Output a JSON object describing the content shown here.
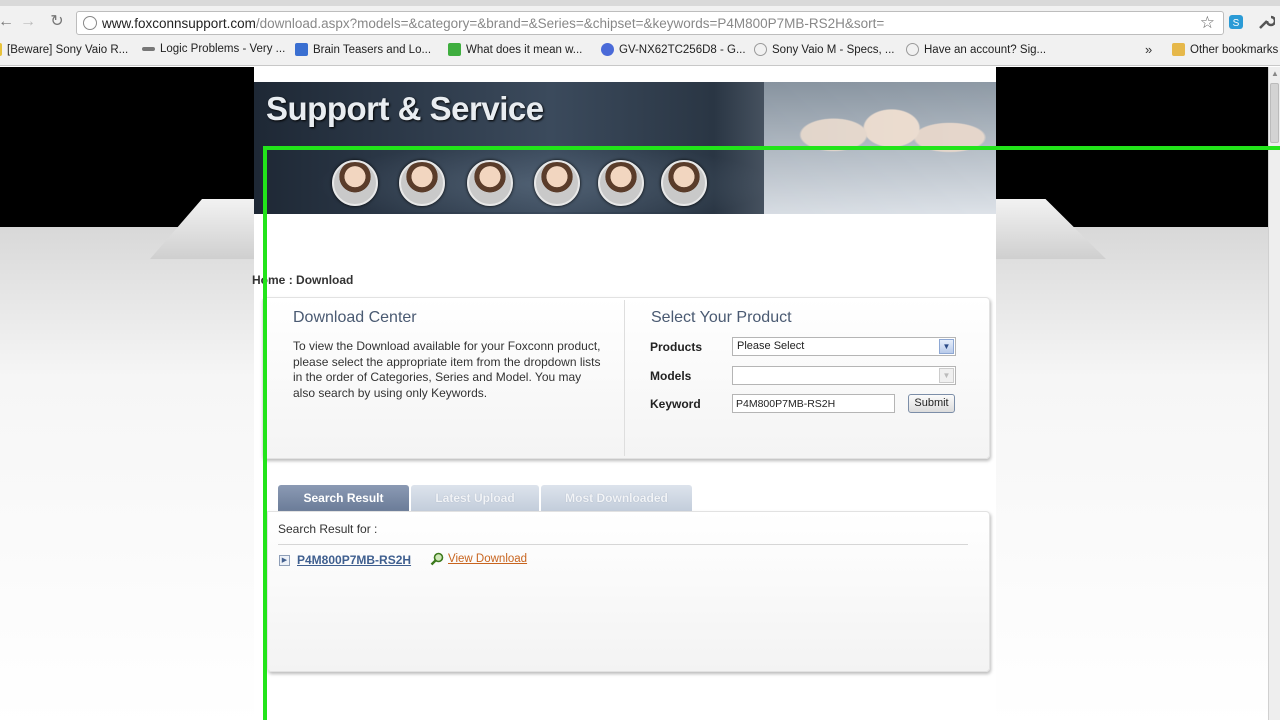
{
  "browser": {
    "url_main": "www.foxconnsupport.com",
    "url_rest": "/download.aspx?models=&category=&brand=&Series=&chipset=&keywords=P4M800P7MB-RS2H&sort=",
    "bookmarks": [
      {
        "label": "[Beware] Sony Vaio R...",
        "color": "#e8c23a"
      },
      {
        "label": "Logic Problems - Very ...",
        "color": "#777777"
      },
      {
        "label": "Brain Teasers and Lo...",
        "color": "#3a6fd1"
      },
      {
        "label": "What does it mean w...",
        "color": "#3fae3f"
      },
      {
        "label": "GV-NX62TC256D8 - G...",
        "color": "#4a6ad8"
      },
      {
        "label": "Sony Vaio M - Specs, ...",
        "color": "#9a9a9a"
      },
      {
        "label": "Have an account? Sig...",
        "color": "#9a9a9a"
      }
    ],
    "more_label": "»",
    "other_bookmarks": "Other bookmarks"
  },
  "banner": {
    "title": "Support & Service"
  },
  "breadcrumb": {
    "home": "Home",
    "separator": ":",
    "current": "Download"
  },
  "download_center": {
    "title": "Download Center",
    "text": "To view the Download available for your Foxconn product, please select the appropriate item from the dropdown lists in the order of Categories, Series and Model. You may also search by using only Keywords."
  },
  "select_product": {
    "title": "Select Your Product",
    "products_label": "Products",
    "products_value": "Please Select",
    "models_label": "Models",
    "models_value": "",
    "keyword_label": "Keyword",
    "keyword_value": "P4M800P7MB-RS2H",
    "submit_label": "Submit"
  },
  "tabs": [
    {
      "label": "Search Result"
    },
    {
      "label": "Latest Upload"
    },
    {
      "label": "Most Downloaded"
    }
  ],
  "results": {
    "search_result_for": "Search Result for :",
    "model": "P4M800P7MB-RS2H",
    "view_download": "View Download"
  }
}
